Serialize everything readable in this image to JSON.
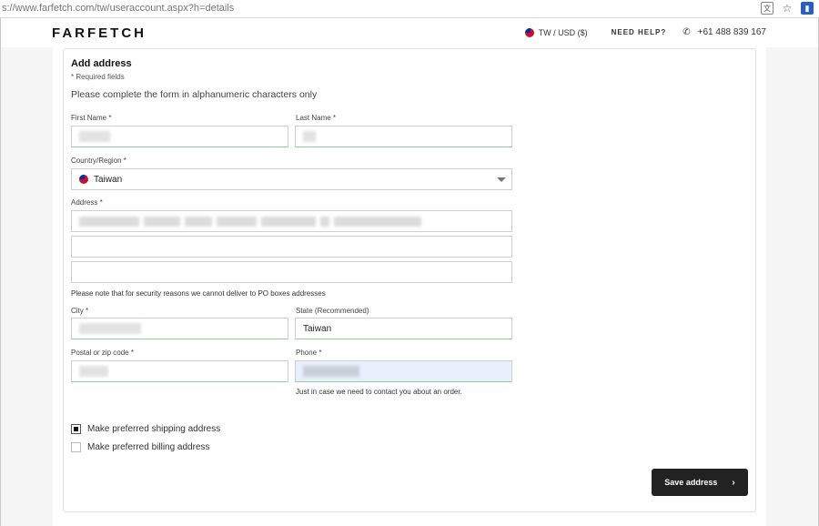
{
  "browser": {
    "url": "s://www.farfetch.com/tw/useraccount.aspx?h=details",
    "icons": [
      "translate-icon",
      "star-icon",
      "bookmark-icon"
    ]
  },
  "header": {
    "logo": "FARFETCH",
    "locale": "TW / USD ($)",
    "help": "NEED HELP?",
    "phone": "+61 488 839 167"
  },
  "form": {
    "title": "Add address",
    "required_note": "* Required fields",
    "intro": "Please complete the form in alphanumeric characters only",
    "first_name": {
      "label": "First Name *",
      "value": ""
    },
    "last_name": {
      "label": "Last Name *",
      "value": ""
    },
    "country": {
      "label": "Country/Region *",
      "value": "Taiwan"
    },
    "address": {
      "label": "Address *",
      "line1": "",
      "line2": "",
      "line3": ""
    },
    "po_note": "Please note that for security reasons we cannot deliver to PO boxes addresses",
    "city": {
      "label": "City *",
      "value": ""
    },
    "state": {
      "label": "State (Recommended)",
      "value": "Taiwan"
    },
    "postal": {
      "label": "Postal or zip code *",
      "value": ""
    },
    "phone": {
      "label": "Phone *",
      "value": "",
      "hint": "Just in case we need to contact you about an order."
    },
    "shipping_checkbox": {
      "label": "Make preferred shipping address",
      "checked": true
    },
    "billing_checkbox": {
      "label": "Make preferred billing address",
      "checked": false
    },
    "save_label": "Save address"
  },
  "colors": {
    "accent_border": "#8fd19e",
    "button": "#222222",
    "autofill": "#e8f0fe"
  }
}
